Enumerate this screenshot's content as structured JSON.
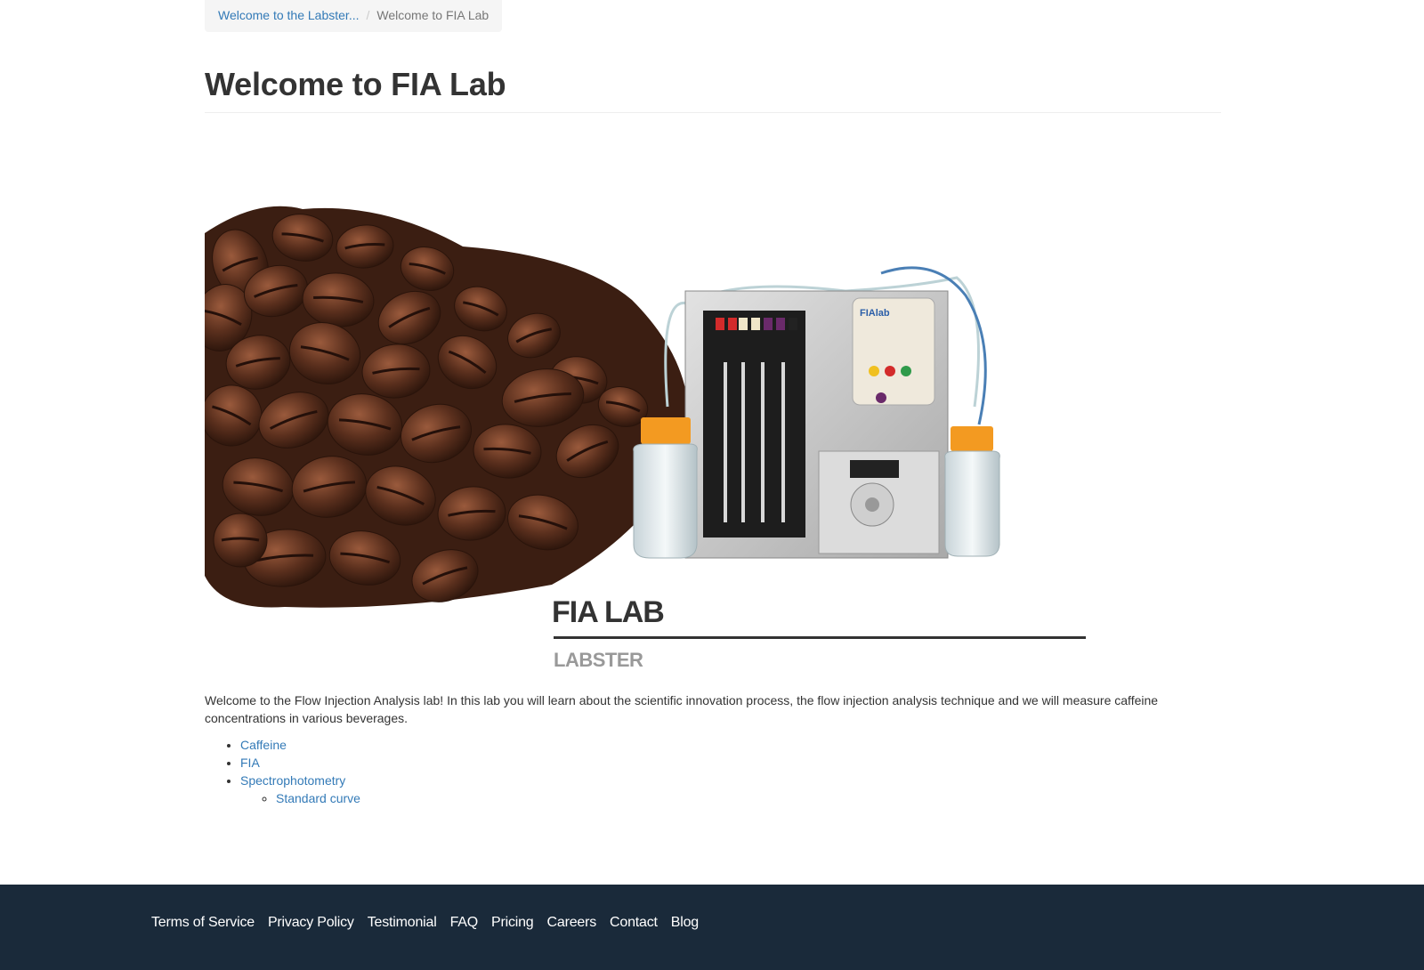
{
  "breadcrumb": {
    "parent": "Welcome to the Labster...",
    "separator": "/",
    "current": "Welcome to FIA Lab"
  },
  "page": {
    "title": "Welcome to FIA Lab"
  },
  "hero": {
    "brand_title": "FIA LAB",
    "brand_subtitle": "LABSTER",
    "device_label": "FIAlab",
    "bean_color": "#5a2f1d",
    "accent_orange": "#f39a21"
  },
  "content": {
    "intro": "Welcome to the Flow Injection Analysis lab! In this lab you will learn about the scientific innovation process, the flow injection analysis technique and we will measure caffeine concentrations in various beverages.",
    "topics": [
      {
        "label": "Caffeine"
      },
      {
        "label": "FIA"
      },
      {
        "label": "Spectrophotometry",
        "children": [
          {
            "label": "Standard curve"
          }
        ]
      }
    ]
  },
  "footer": {
    "links": [
      "Terms of Service",
      "Privacy Policy",
      "Testimonial",
      "FAQ",
      "Pricing",
      "Careers",
      "Contact",
      "Blog"
    ],
    "background": "#1a2a3a"
  }
}
